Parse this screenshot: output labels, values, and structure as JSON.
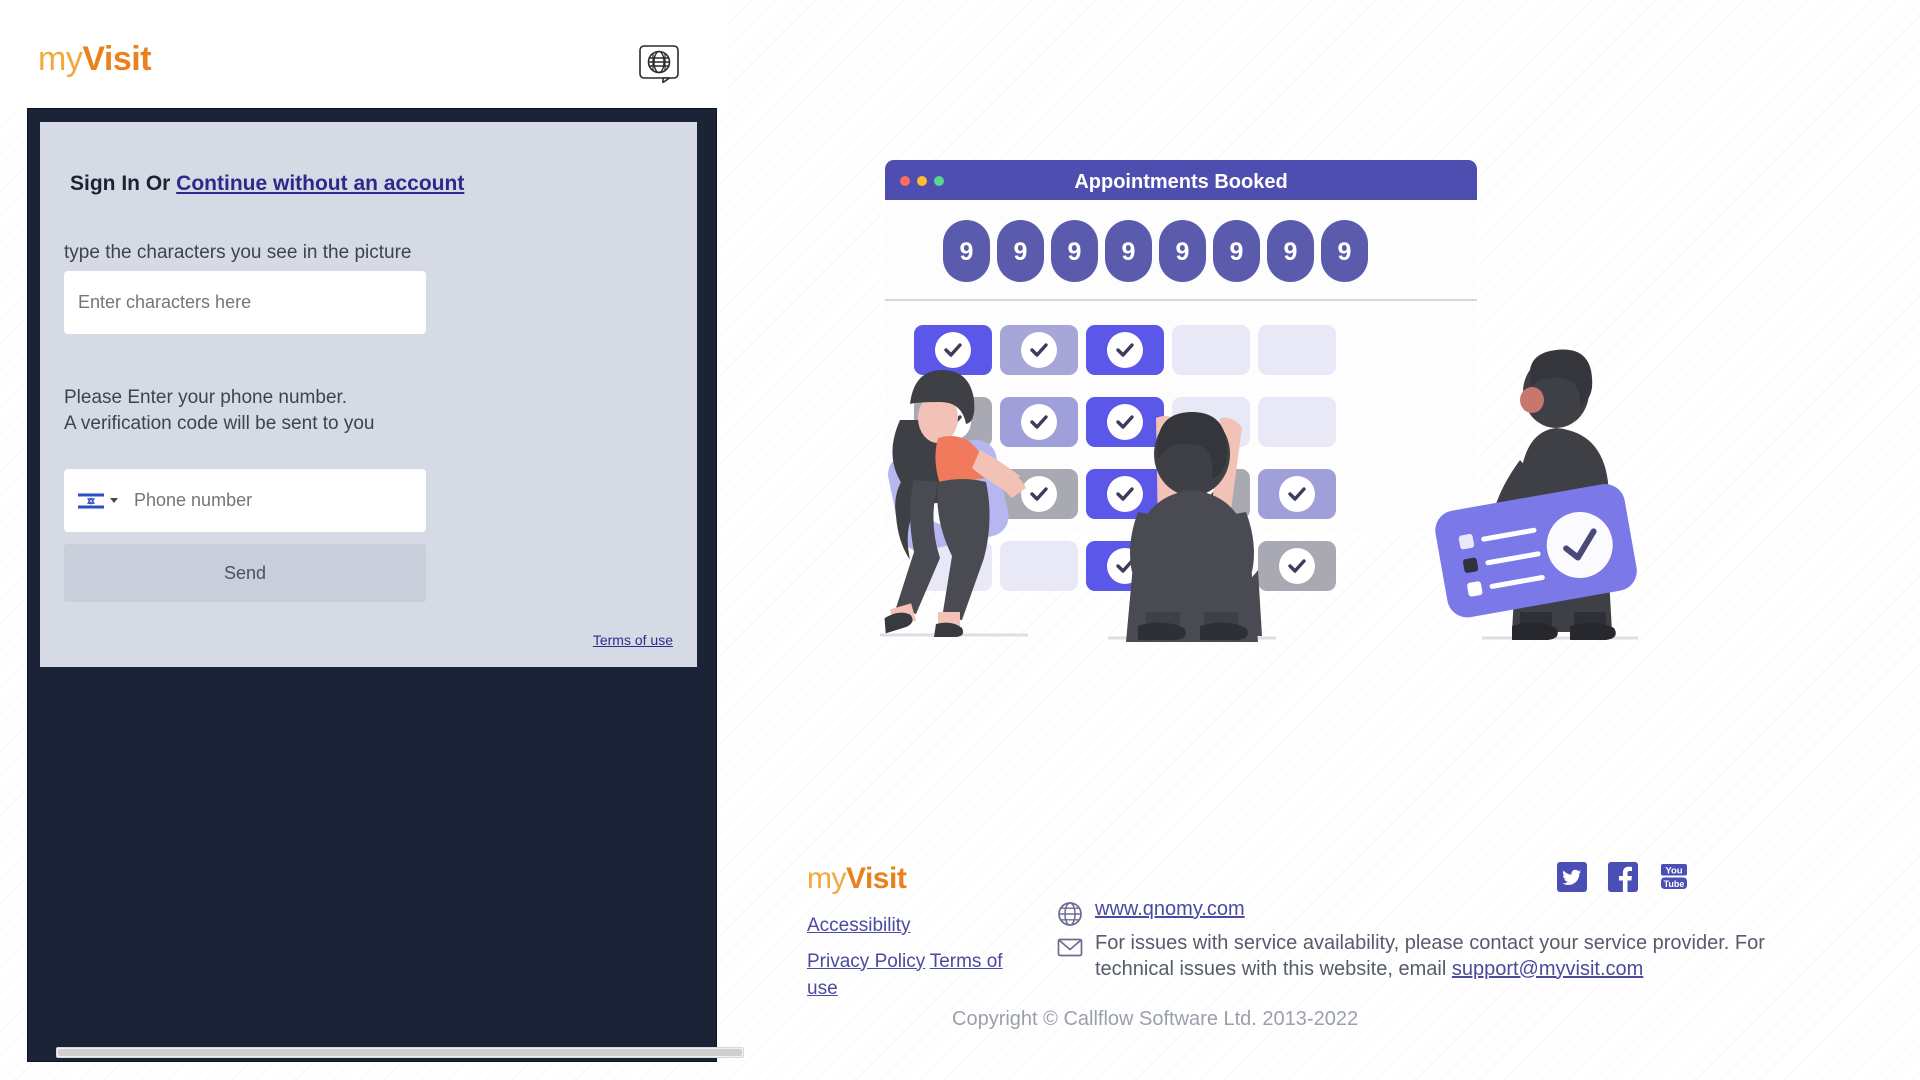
{
  "header": {
    "brand_my": "my",
    "brand_visit": "Visit",
    "language_icon": "globe-speech-bubble-icon"
  },
  "login": {
    "signin_prefix": "Sign In Or ",
    "continue_link": "Continue without an account",
    "captcha_label": "type the characters you see in the picture",
    "captcha_placeholder": "Enter characters here",
    "captcha_value": "",
    "phone_label": "Please Enter your phone number.\nA verification code will be sent to you",
    "country_flag": "israel-flag-icon",
    "phone_placeholder": "Phone number",
    "phone_value": "",
    "send_label": "Send",
    "terms_link": "Terms of use"
  },
  "illustration": {
    "window_title": "Appointments Booked",
    "badge_values": [
      "9",
      "9",
      "9",
      "9",
      "9",
      "9",
      "9",
      "9"
    ],
    "traffic_lights": [
      "#ff6b5e",
      "#ffbd2e",
      "#5bd68a"
    ],
    "title_bar_color": "#4e4eb0",
    "grid": [
      [
        "strong",
        "light",
        "strong",
        "empty",
        "empty"
      ],
      [
        "gray",
        "mid",
        "strong",
        "empty",
        "empty"
      ],
      [
        "empty",
        "gray",
        "strong",
        "gray",
        "mid"
      ],
      [
        "empty",
        "empty",
        "strong",
        "mid",
        "gray"
      ]
    ]
  },
  "footer": {
    "brand_my": "my",
    "brand_visit": "Visit",
    "accessibility_link": "Accessibility",
    "privacy_link": "Privacy Policy",
    "terms_link": "Terms of use",
    "website_icon": "globe-icon",
    "website_link": "www.qnomy.com",
    "mail_icon": "envelope-icon",
    "support_line1": "For issues with service availability, please contact your service provider. For",
    "support_line2_prefix": "technical issues with this website, email ",
    "support_email": "support@myvisit.com",
    "copyright": "Copyright © Callflow Software Ltd. 2013-2022",
    "social": [
      {
        "name": "twitter-icon",
        "label": "Twitter"
      },
      {
        "name": "facebook-icon",
        "label": "Facebook"
      },
      {
        "name": "youtube-icon",
        "label": "YouTube"
      }
    ]
  },
  "colors": {
    "brand_orange_light": "#F0A93B",
    "brand_orange_dark": "#E8821E",
    "panel_navy": "#1b2436",
    "card_gray": "#d6dae4",
    "link_purple": "#2a2a8c",
    "accent_purple": "#4e4eb0",
    "badge_purple": "#5b5bae"
  }
}
